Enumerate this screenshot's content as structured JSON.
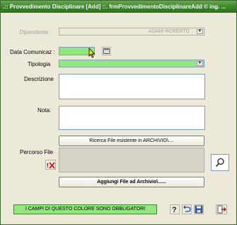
{
  "window": {
    "title": ".:: Provvedimento Disciplinare [Add] ::.   frmProvvedimentoDisciplinareAdd © ing. ..."
  },
  "form": {
    "dipendente_label": "Dipendente :",
    "dipendente_value": "ADAMI  ROBERTO",
    "data_comunicaz_label": "Data Comunicaz :",
    "data_comunicaz_value": "",
    "tipologia_label": "Tipologia",
    "tipologia_value": "",
    "descrizione_label": "Descrizione",
    "descrizione_value": "",
    "nota_label": "Nota:",
    "nota_value": "",
    "percorso_file_label": "Percorso File",
    "percorso_file_value": ""
  },
  "buttons": {
    "ricerca_file": "Ricerca File esistente in ARCHIVIO\\....",
    "aggiungi_file": "Aggiungi File ad Archivio\\......"
  },
  "status": {
    "required_note": "I CAMPI DI QUESTO COLORE SONO OBBLIGATORI"
  },
  "colors": {
    "title_bar": "#3d8a2d",
    "required_field": "#92e87f",
    "window_bg": "#ece9d8"
  },
  "icons": {
    "calendar": "calendar-icon",
    "delete_file": "delete-file-icon",
    "search": "search-icon",
    "help": "help-icon",
    "undo": "undo-icon",
    "save": "save-icon",
    "exit": "exit-icon"
  }
}
